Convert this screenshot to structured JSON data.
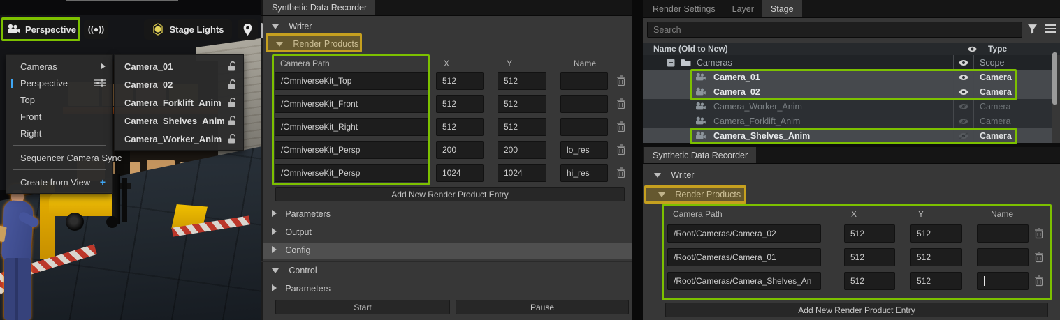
{
  "colors": {
    "highlight_green": "#7cc000",
    "highlight_gold": "#c6a01f",
    "selection_blue": "#3fa7f5",
    "panel_bg": "#373737"
  },
  "icons": {
    "live_sync_glyph": "((●))"
  },
  "viewport": {
    "toolbar": {
      "camera_button": "Perspective",
      "live_sync_glyph": "((●))",
      "stage_lights_button": "Stage Lights"
    },
    "camera_menu": {
      "items": [
        {
          "label": "Cameras",
          "arrow": true
        },
        {
          "label": "Perspective",
          "active": true,
          "sliders": true
        },
        {
          "label": "Top"
        },
        {
          "label": "Front"
        },
        {
          "label": "Right"
        },
        {
          "cls": "divider"
        },
        {
          "label": "Sequencer Camera Sync"
        },
        {
          "cls": "divider"
        },
        {
          "label": "Create from View",
          "plus": true
        }
      ]
    },
    "camera_submenu": {
      "items": [
        {
          "label": "Camera_01"
        },
        {
          "label": "Camera_02"
        },
        {
          "label": "Camera_Forklift_Anim"
        },
        {
          "label": "Camera_Shelves_Anim"
        },
        {
          "label": "Camera_Worker_Anim"
        }
      ]
    }
  },
  "sdr_left": {
    "tab": "Synthetic Data Recorder",
    "writer_label": "Writer",
    "render_products_label": "Render Products",
    "headers": {
      "path": "Camera Path",
      "x": "X",
      "y": "Y",
      "name": "Name"
    },
    "rows": [
      {
        "path": "/OmniverseKit_Top",
        "x": "512",
        "y": "512",
        "name": ""
      },
      {
        "path": "/OmniverseKit_Front",
        "x": "512",
        "y": "512",
        "name": ""
      },
      {
        "path": "/OmniverseKit_Right",
        "x": "512",
        "y": "512",
        "name": ""
      },
      {
        "path": "/OmniverseKit_Persp",
        "x": "200",
        "y": "200",
        "name": "lo_res"
      },
      {
        "path": "/OmniverseKit_Persp",
        "x": "1024",
        "y": "1024",
        "name": "hi_res"
      }
    ],
    "add_button": "Add New Render Product Entry",
    "parameters_label": "Parameters",
    "output_label": "Output",
    "config_label": "Config",
    "control_label": "Control",
    "control_parameters_label": "Parameters",
    "start_button": "Start",
    "pause_button": "Pause"
  },
  "stage": {
    "tabs": [
      {
        "label": "Render Settings"
      },
      {
        "label": "Layer"
      },
      {
        "label": "Stage",
        "cls": "active"
      }
    ],
    "search_placeholder": "Search",
    "name_column": "Name (Old to New)",
    "type_column": "Type",
    "rows": [
      {
        "name": "Cameras",
        "type": "Scope",
        "cls": "scope",
        "folder": true,
        "toggle": true,
        "visible": true
      },
      {
        "name": "Camera_01",
        "type": "Camera",
        "cls": "selected",
        "camera": true,
        "visible": true
      },
      {
        "name": "Camera_02",
        "type": "Camera",
        "cls": "selected",
        "camera": true,
        "visible": true
      },
      {
        "name": "Camera_Worker_Anim",
        "type": "Camera",
        "cls": "dim",
        "camera": true,
        "visible": false
      },
      {
        "name": "Camera_Forklift_Anim",
        "type": "Camera",
        "cls": "dim",
        "camera": true,
        "visible": false
      },
      {
        "name": "Camera_Shelves_Anim",
        "type": "Camera",
        "cls": "selected",
        "camera": true,
        "visible": false
      }
    ]
  },
  "sdr_right": {
    "tab": "Synthetic Data Recorder",
    "writer_label": "Writer",
    "render_products_label": "Render Products",
    "headers": {
      "path": "Camera Path",
      "x": "X",
      "y": "Y",
      "name": "Name"
    },
    "rows": [
      {
        "path": "/Root/Cameras/Camera_02",
        "x": "512",
        "y": "512",
        "name": ""
      },
      {
        "path": "/Root/Cameras/Camera_01",
        "x": "512",
        "y": "512",
        "name": ""
      },
      {
        "path": "/Root/Cameras/Camera_Shelves_An",
        "x": "512",
        "y": "512",
        "name": "",
        "caret": true
      }
    ],
    "add_button": "Add New Render Product Entry"
  }
}
